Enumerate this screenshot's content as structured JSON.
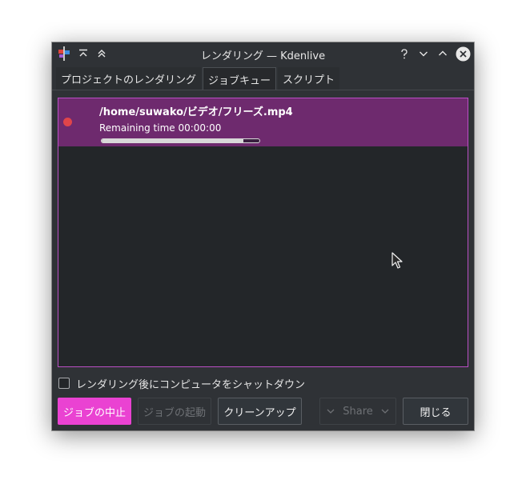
{
  "window": {
    "title": "レンダリング — Kdenlive"
  },
  "titlebar_buttons": [
    "help-icon",
    "minimize-icon",
    "maximize-icon",
    "close-icon"
  ],
  "tabs": [
    {
      "label": "プロジェクトのレンダリング",
      "active": false
    },
    {
      "label": "ジョブキュー",
      "active": true
    },
    {
      "label": "スクリプト",
      "active": false
    }
  ],
  "job": {
    "file": "/home/suwako/ビデオ/フリーズ.mp4",
    "remaining": "Remaining time 00:00:00",
    "progress": 0.9,
    "status_icon": "record-dot-icon"
  },
  "shutdown": {
    "label": "レンダリング後にコンピュータをシャットダウン",
    "checked": false
  },
  "buttons": {
    "abort": "ジョブの中止",
    "start": "ジョブの起動",
    "cleanup": "クリーンアップ",
    "share": "Share",
    "close": "閉じる"
  },
  "colors": {
    "accent": "#ea42d2",
    "selection": "#6e2a6e",
    "panel_border": "#bb4fc6",
    "window_bg": "#2f3236",
    "list_bg": "#232629",
    "status_dot": "#e0454a"
  }
}
